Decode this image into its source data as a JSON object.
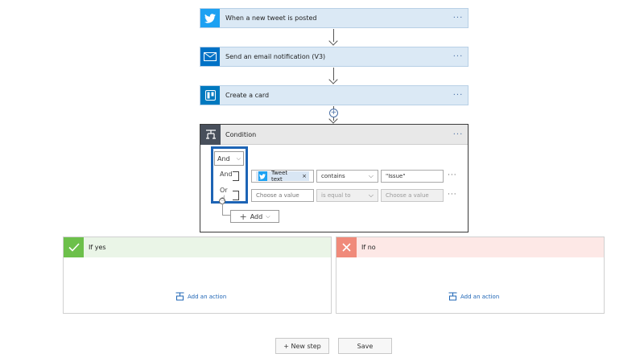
{
  "steps": [
    {
      "title": "When a new tweet is posted",
      "icon": "twitter-bird-icon",
      "color": "#1da1f2",
      "menu": "···"
    },
    {
      "title": "Send an email notification (V3)",
      "icon": "mail-envelope-icon",
      "color": "#0072c6",
      "menu": "···"
    },
    {
      "title": "Create a card",
      "icon": "trello-icon",
      "color": "#0079bf",
      "menu": "···"
    }
  ],
  "condition": {
    "title": "Condition",
    "menu": "···",
    "group_operator": "And",
    "operator_options": [
      "And",
      "Or"
    ],
    "rows": [
      {
        "left_token": "Tweet text",
        "operator": "contains",
        "value": "\"Issue\""
      },
      {
        "left_placeholder": "Choose a value",
        "operator": "is equal to",
        "value_placeholder": "Choose a value"
      }
    ],
    "add_label": "Add"
  },
  "branches": {
    "yes": {
      "title": "If yes",
      "add_action": "Add an action"
    },
    "no": {
      "title": "If no",
      "add_action": "Add an action"
    }
  },
  "footer": {
    "new_step": "+ New step",
    "save": "Save"
  },
  "colors": {
    "accent": "#1d64b5",
    "yes": "#6cc04a",
    "no": "#f08a7a",
    "card_bg": "#dbe9f5"
  }
}
